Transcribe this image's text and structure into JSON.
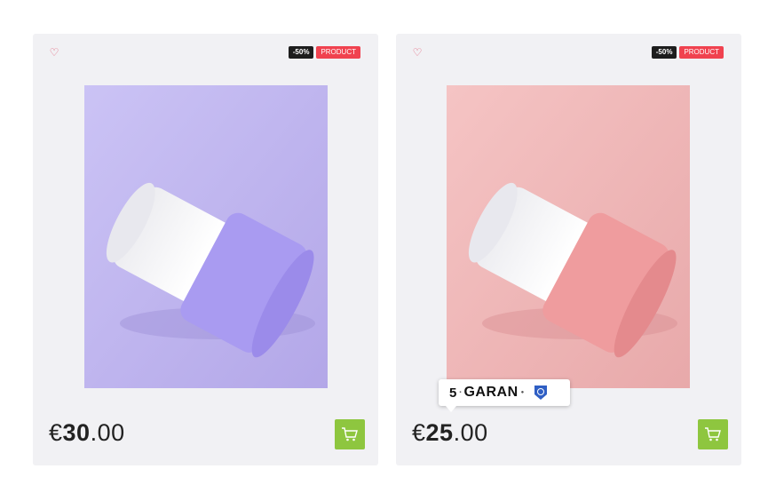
{
  "products": [
    {
      "discount_badge": "-50%",
      "type_badge": "PRODUCT",
      "price_currency": "€",
      "price_whole": "30",
      "price_cents": ".00",
      "image_colors": {
        "background": "#c2b8ef",
        "lid": "#a99bf1"
      },
      "favorite_icon": "heart-outline-icon",
      "cart_icon": "shopping-cart-icon"
    },
    {
      "discount_badge": "-50%",
      "type_badge": "PRODUCT",
      "price_currency": "€",
      "price_whole": "25",
      "price_cents": ".00",
      "image_colors": {
        "background": "#f3b8b8",
        "lid": "#ef9c9e"
      },
      "favorite_icon": "heart-outline-icon",
      "cart_icon": "shopping-cart-icon"
    }
  ],
  "warranty_sticker": {
    "number": "5",
    "small_text": "",
    "text": "GARAN"
  },
  "colors": {
    "card_bg": "#f1f1f4",
    "discount_bg": "#1d1d1d",
    "product_badge_bg": "#f0424f",
    "cart_bg": "#8ec63f",
    "heart": "#e0516b"
  }
}
